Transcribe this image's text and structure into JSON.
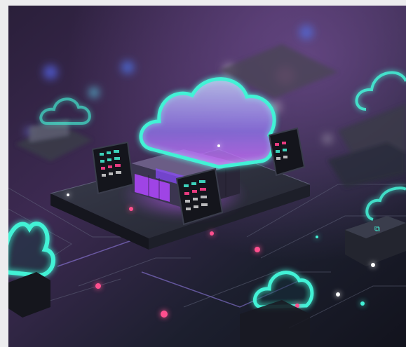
{
  "image": {
    "subject": "cloud-computing-illustration",
    "colors": {
      "page_background": "#ececee",
      "scene_dark": "#1b1a2a",
      "scene_purple": "#4a2a5e",
      "glow_cyan": "#43f2d6",
      "glow_violet": "#b45cff",
      "accent_pink": "#ff3f8a"
    }
  }
}
